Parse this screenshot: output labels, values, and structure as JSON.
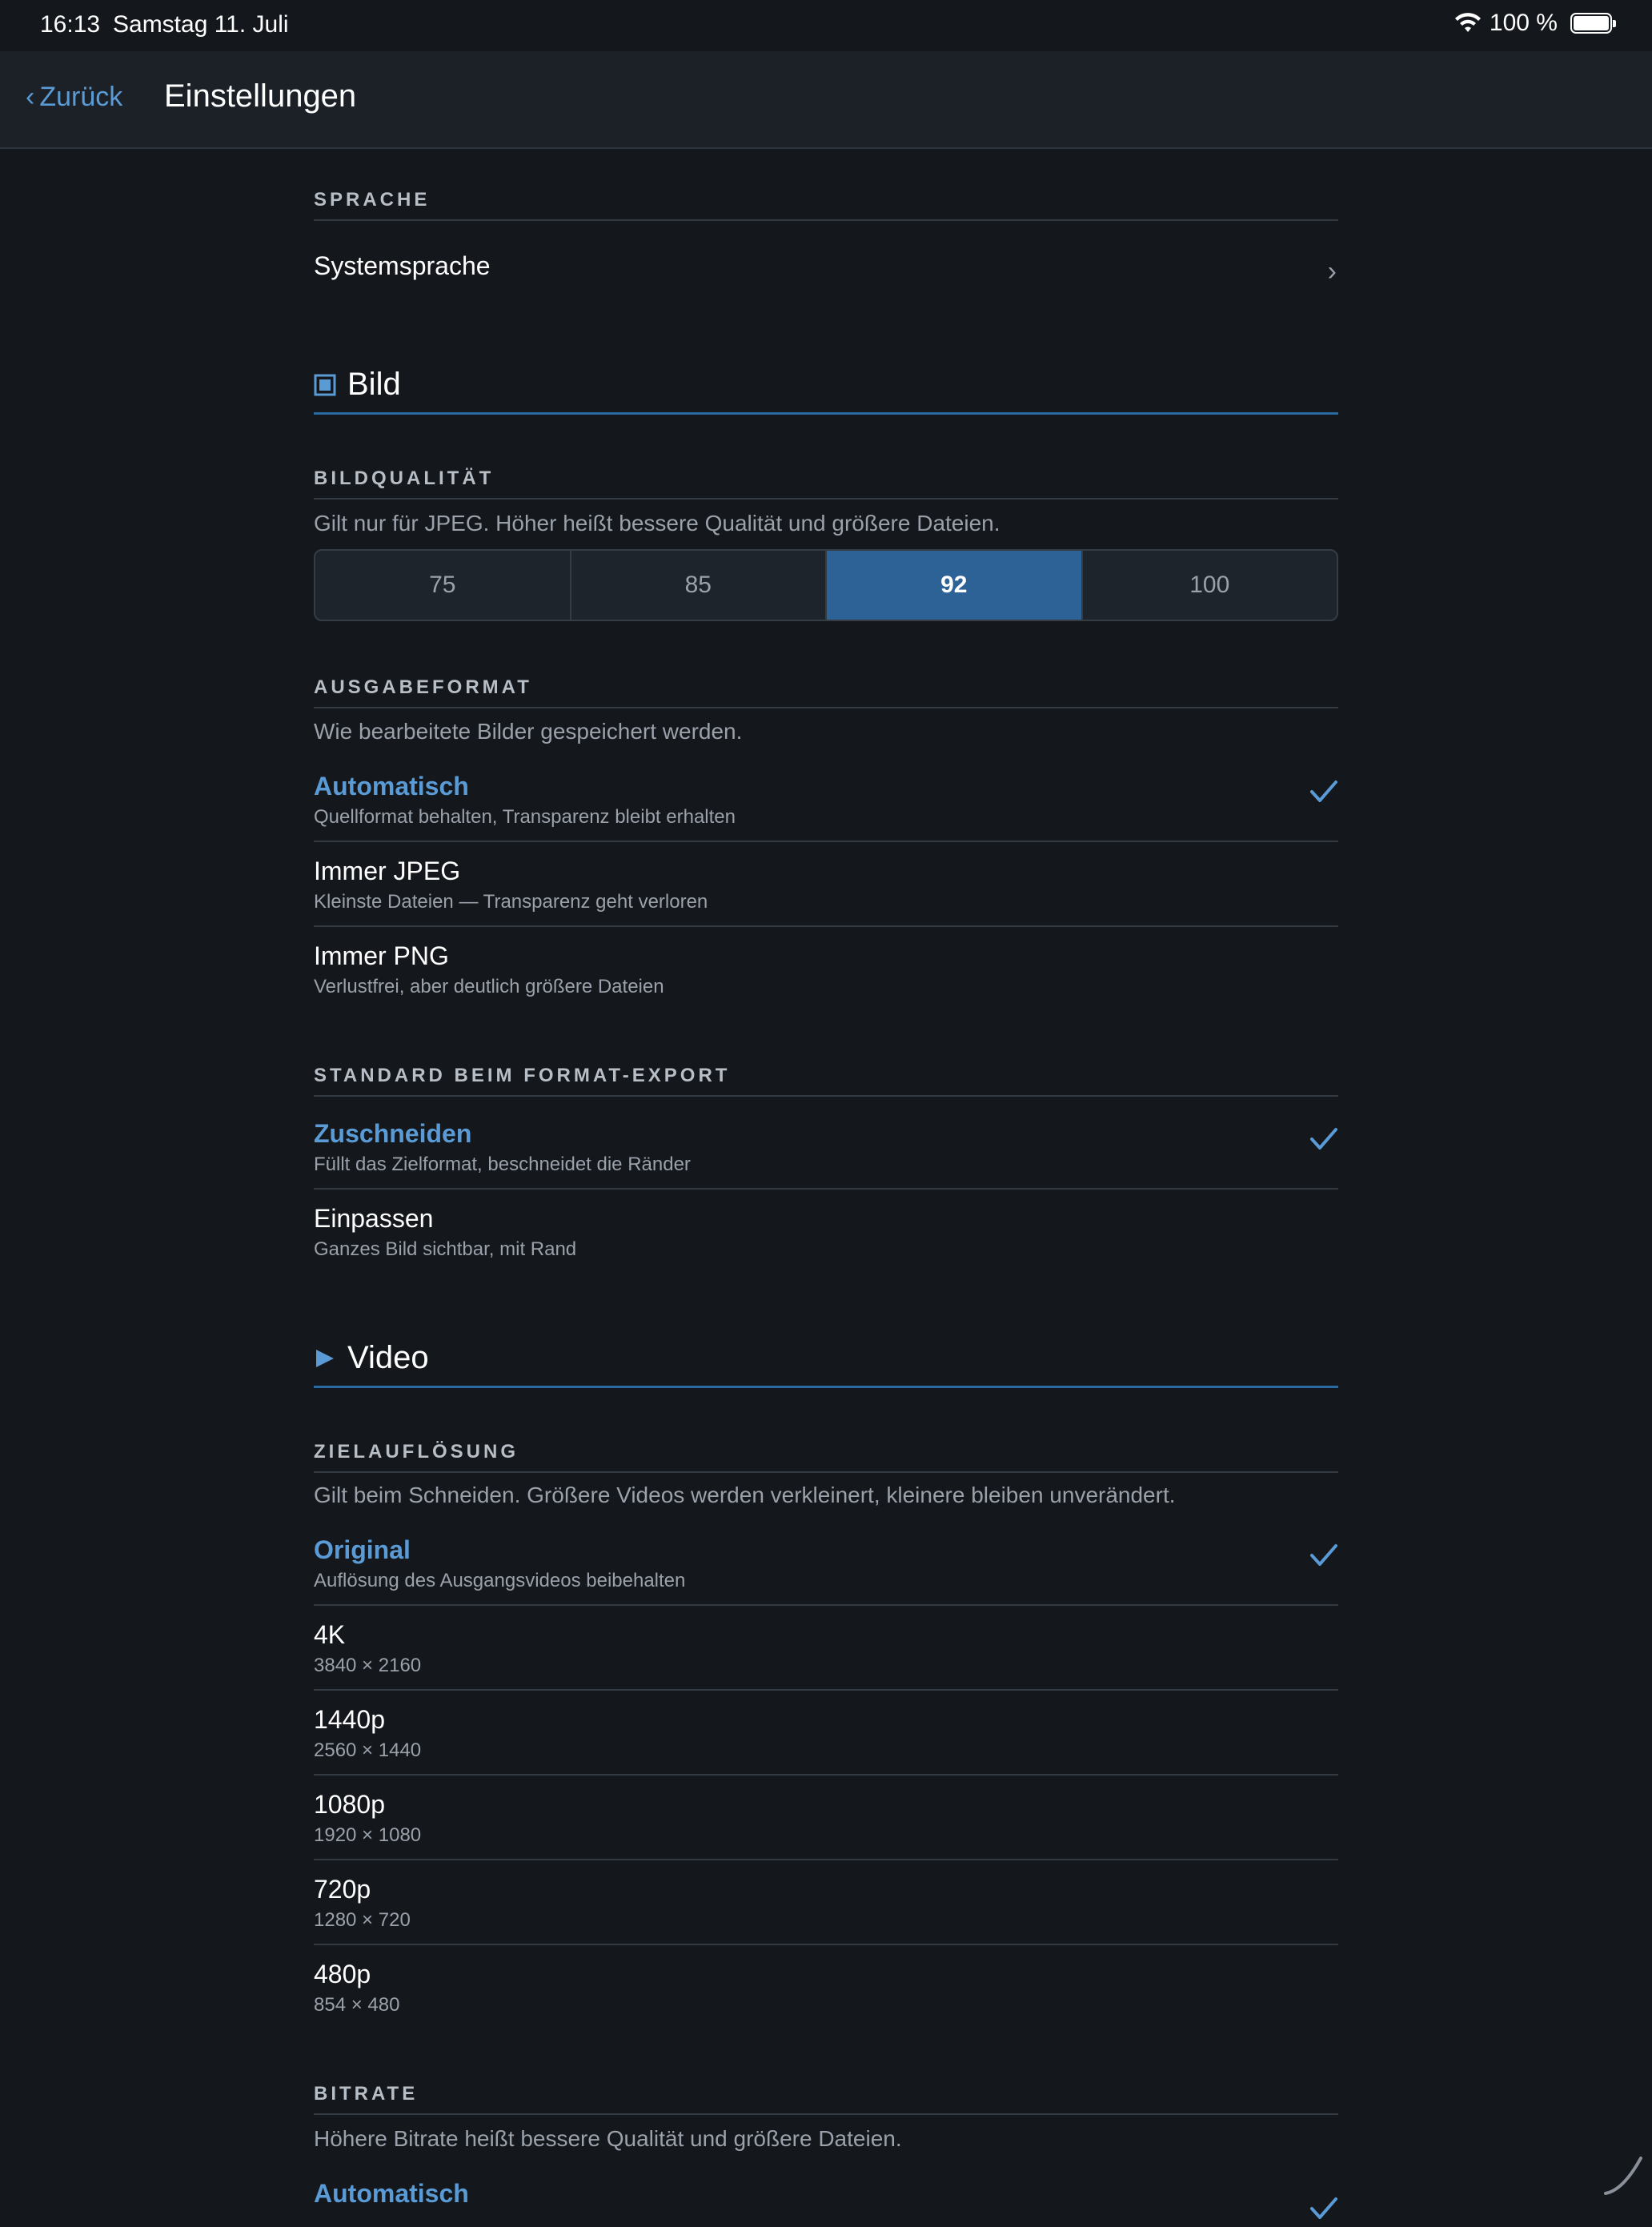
{
  "status_bar": {
    "time": "16:13",
    "date": "Samstag 11. Juli",
    "battery": "100 %"
  },
  "nav": {
    "back_label": "Zurück",
    "title": "Einstellungen"
  },
  "language": {
    "header": "SPRACHE",
    "item": "Systemsprache"
  },
  "image": {
    "title": "Bild",
    "quality": {
      "header": "BILDQUALITÄT",
      "description": "Gilt nur für JPEG. Höher heißt bessere Qualität und größere Dateien.",
      "options": [
        "75",
        "85",
        "92",
        "100"
      ],
      "selected": "92"
    },
    "output_format": {
      "header": "AUSGABEFORMAT",
      "description": "Wie bearbeitete Bilder gespeichert werden.",
      "options": [
        {
          "label": "Automatisch",
          "sub": "Quellformat behalten, Transparenz bleibt erhalten"
        },
        {
          "label": "Immer JPEG",
          "sub": "Kleinste Dateien — Transparenz geht verloren"
        },
        {
          "label": "Immer PNG",
          "sub": "Verlustfrei, aber deutlich größere Dateien"
        }
      ]
    },
    "format_export": {
      "header": "STANDARD BEIM FORMAT-EXPORT",
      "options": [
        {
          "label": "Zuschneiden",
          "sub": "Füllt das Zielformat, beschneidet die Ränder"
        },
        {
          "label": "Einpassen",
          "sub": "Ganzes Bild sichtbar, mit Rand"
        }
      ]
    }
  },
  "video": {
    "title": "Video",
    "resolution": {
      "header": "ZIELAUFLÖSUNG",
      "description": "Gilt beim Schneiden. Größere Videos werden verkleinert, kleinere bleiben unverändert.",
      "options": [
        {
          "label": "Original",
          "sub": "Auflösung des Ausgangsvideos beibehalten"
        },
        {
          "label": "4K",
          "sub": "3840 × 2160"
        },
        {
          "label": "1440p",
          "sub": "2560 × 1440"
        },
        {
          "label": "1080p",
          "sub": "1920 × 1080"
        },
        {
          "label": "720p",
          "sub": "1280 × 720"
        },
        {
          "label": "480p",
          "sub": "854 × 480"
        }
      ]
    },
    "bitrate": {
      "header": "BITRATE",
      "description": "Höhere Bitrate heißt bessere Qualität und größere Dateien.",
      "first_option": "Automatisch"
    }
  },
  "colors": {
    "accent": "#5b9bd5",
    "segment_active": "#2d6296",
    "background": "#14171c"
  }
}
